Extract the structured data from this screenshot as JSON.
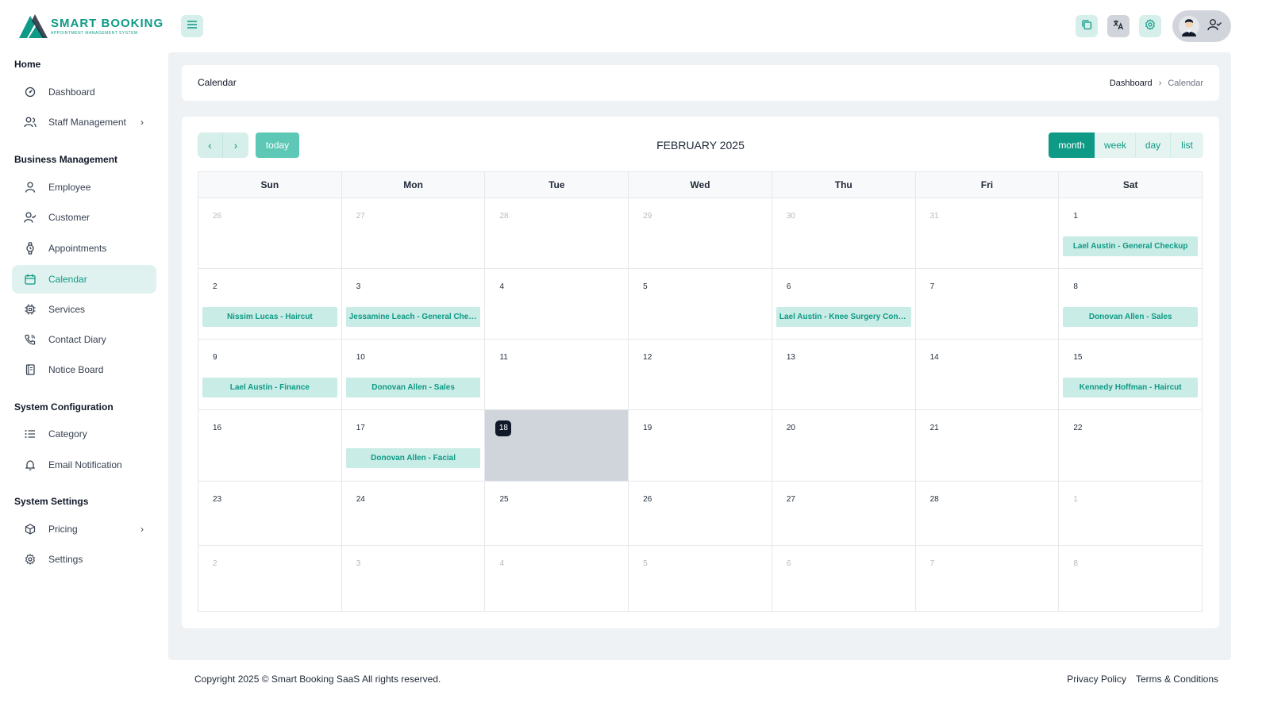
{
  "app": {
    "logo_title": "SMART BOOKING",
    "logo_subtitle": "APPOINTMENT MANAGEMENT SYSTEM",
    "accent": "#0e9a85"
  },
  "sidebar": {
    "sections": [
      {
        "title": "Home",
        "items": [
          {
            "label": "Dashboard",
            "icon": "dashboard-icon"
          },
          {
            "label": "Staff Management",
            "icon": "staff-icon",
            "has_submenu": true
          }
        ]
      },
      {
        "title": "Business Management",
        "items": [
          {
            "label": "Employee",
            "icon": "user-icon"
          },
          {
            "label": "Customer",
            "icon": "user-check-icon"
          },
          {
            "label": "Appointments",
            "icon": "watch-icon"
          },
          {
            "label": "Calendar",
            "icon": "calendar-icon",
            "active": true
          },
          {
            "label": "Services",
            "icon": "chip-icon"
          },
          {
            "label": "Contact Diary",
            "icon": "phone-icon"
          },
          {
            "label": "Notice Board",
            "icon": "notebook-icon"
          }
        ]
      },
      {
        "title": "System Configuration",
        "items": [
          {
            "label": "Category",
            "icon": "list-icon"
          },
          {
            "label": "Email Notification",
            "icon": "bell-icon"
          }
        ]
      },
      {
        "title": "System Settings",
        "items": [
          {
            "label": "Pricing",
            "icon": "package-icon",
            "has_submenu": true
          },
          {
            "label": "Settings",
            "icon": "gear-icon"
          }
        ]
      }
    ]
  },
  "page": {
    "title": "Calendar",
    "breadcrumb": [
      "Dashboard",
      "Calendar"
    ]
  },
  "calendar": {
    "title": "FEBRUARY 2025",
    "today_label": "today",
    "views": [
      "month",
      "week",
      "day",
      "list"
    ],
    "active_view": "month",
    "days_of_week": [
      "Sun",
      "Mon",
      "Tue",
      "Wed",
      "Thu",
      "Fri",
      "Sat"
    ],
    "weeks": [
      [
        {
          "d": "26",
          "o": true
        },
        {
          "d": "27",
          "o": true
        },
        {
          "d": "28",
          "o": true
        },
        {
          "d": "29",
          "o": true
        },
        {
          "d": "30",
          "o": true
        },
        {
          "d": "31",
          "o": true
        },
        {
          "d": "1",
          "e": "Lael Austin - General Checkup"
        }
      ],
      [
        {
          "d": "2",
          "e": "Nissim Lucas - Haircut"
        },
        {
          "d": "3",
          "e": "Jessamine Leach - General Checkup"
        },
        {
          "d": "4"
        },
        {
          "d": "5"
        },
        {
          "d": "6",
          "e": "Lael Austin - Knee Surgery Consultation"
        },
        {
          "d": "7"
        },
        {
          "d": "8",
          "e": "Donovan Allen - Sales"
        }
      ],
      [
        {
          "d": "9",
          "e": "Lael Austin - Finance"
        },
        {
          "d": "10",
          "e": "Donovan Allen - Sales"
        },
        {
          "d": "11"
        },
        {
          "d": "12"
        },
        {
          "d": "13"
        },
        {
          "d": "14"
        },
        {
          "d": "15",
          "e": "Kennedy Hoffman - Haircut"
        }
      ],
      [
        {
          "d": "16"
        },
        {
          "d": "17",
          "e": "Donovan Allen - Facial"
        },
        {
          "d": "18",
          "t": true
        },
        {
          "d": "19"
        },
        {
          "d": "20"
        },
        {
          "d": "21"
        },
        {
          "d": "22"
        }
      ],
      [
        {
          "d": "23"
        },
        {
          "d": "24"
        },
        {
          "d": "25"
        },
        {
          "d": "26"
        },
        {
          "d": "27"
        },
        {
          "d": "28"
        },
        {
          "d": "1",
          "o": true
        }
      ],
      [
        {
          "d": "2",
          "o": true
        },
        {
          "d": "3",
          "o": true
        },
        {
          "d": "4",
          "o": true
        },
        {
          "d": "5",
          "o": true
        },
        {
          "d": "6",
          "o": true
        },
        {
          "d": "7",
          "o": true
        },
        {
          "d": "8",
          "o": true
        }
      ]
    ]
  },
  "footer": {
    "copyright": "Copyright 2025 © Smart Booking SaaS All rights reserved.",
    "links": [
      "Privacy Policy",
      "Terms & Conditions"
    ]
  }
}
